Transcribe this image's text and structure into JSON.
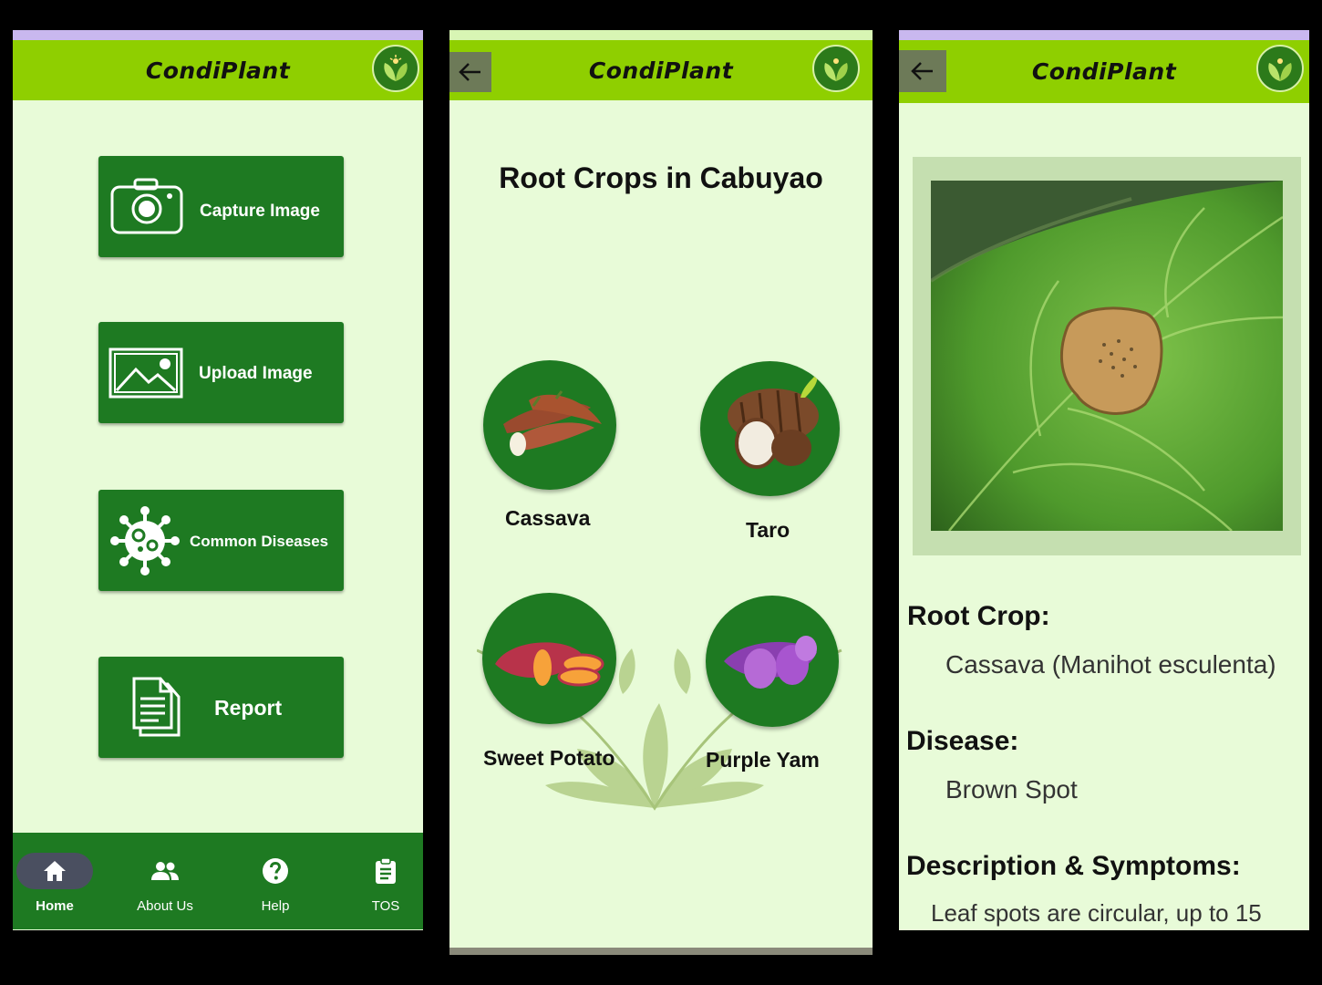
{
  "app": {
    "title": "CondiPlant"
  },
  "home": {
    "buttons": [
      {
        "label": "Capture Image",
        "icon": "camera-icon"
      },
      {
        "label": "Upload Image",
        "icon": "image-icon"
      },
      {
        "label": "Common Diseases",
        "icon": "virus-icon"
      },
      {
        "label": "Report",
        "icon": "document-icon"
      }
    ],
    "nav": [
      {
        "label": "Home",
        "icon": "home-icon",
        "active": true
      },
      {
        "label": "About Us",
        "icon": "people-icon"
      },
      {
        "label": "Help",
        "icon": "help-icon"
      },
      {
        "label": "TOS",
        "icon": "clipboard-icon"
      }
    ]
  },
  "crops": {
    "heading": "Root Crops in Cabuyao",
    "items": [
      {
        "label": "Cassava"
      },
      {
        "label": "Taro"
      },
      {
        "label": "Sweet Potato"
      },
      {
        "label": "Purple Yam"
      }
    ]
  },
  "detail": {
    "root_crop_label": "Root Crop:",
    "root_crop_value": "Cassava (Manihot esculenta)",
    "disease_label": "Disease:",
    "disease_value": "Brown Spot",
    "description_label": "Description & Symptoms:",
    "description_value": "Leaf spots are circular, up to 15"
  },
  "colors": {
    "appbar": "#8fcf00",
    "primary": "#1e7a22",
    "background": "#e8fbd8",
    "status_bar": "#c9b8ef"
  }
}
